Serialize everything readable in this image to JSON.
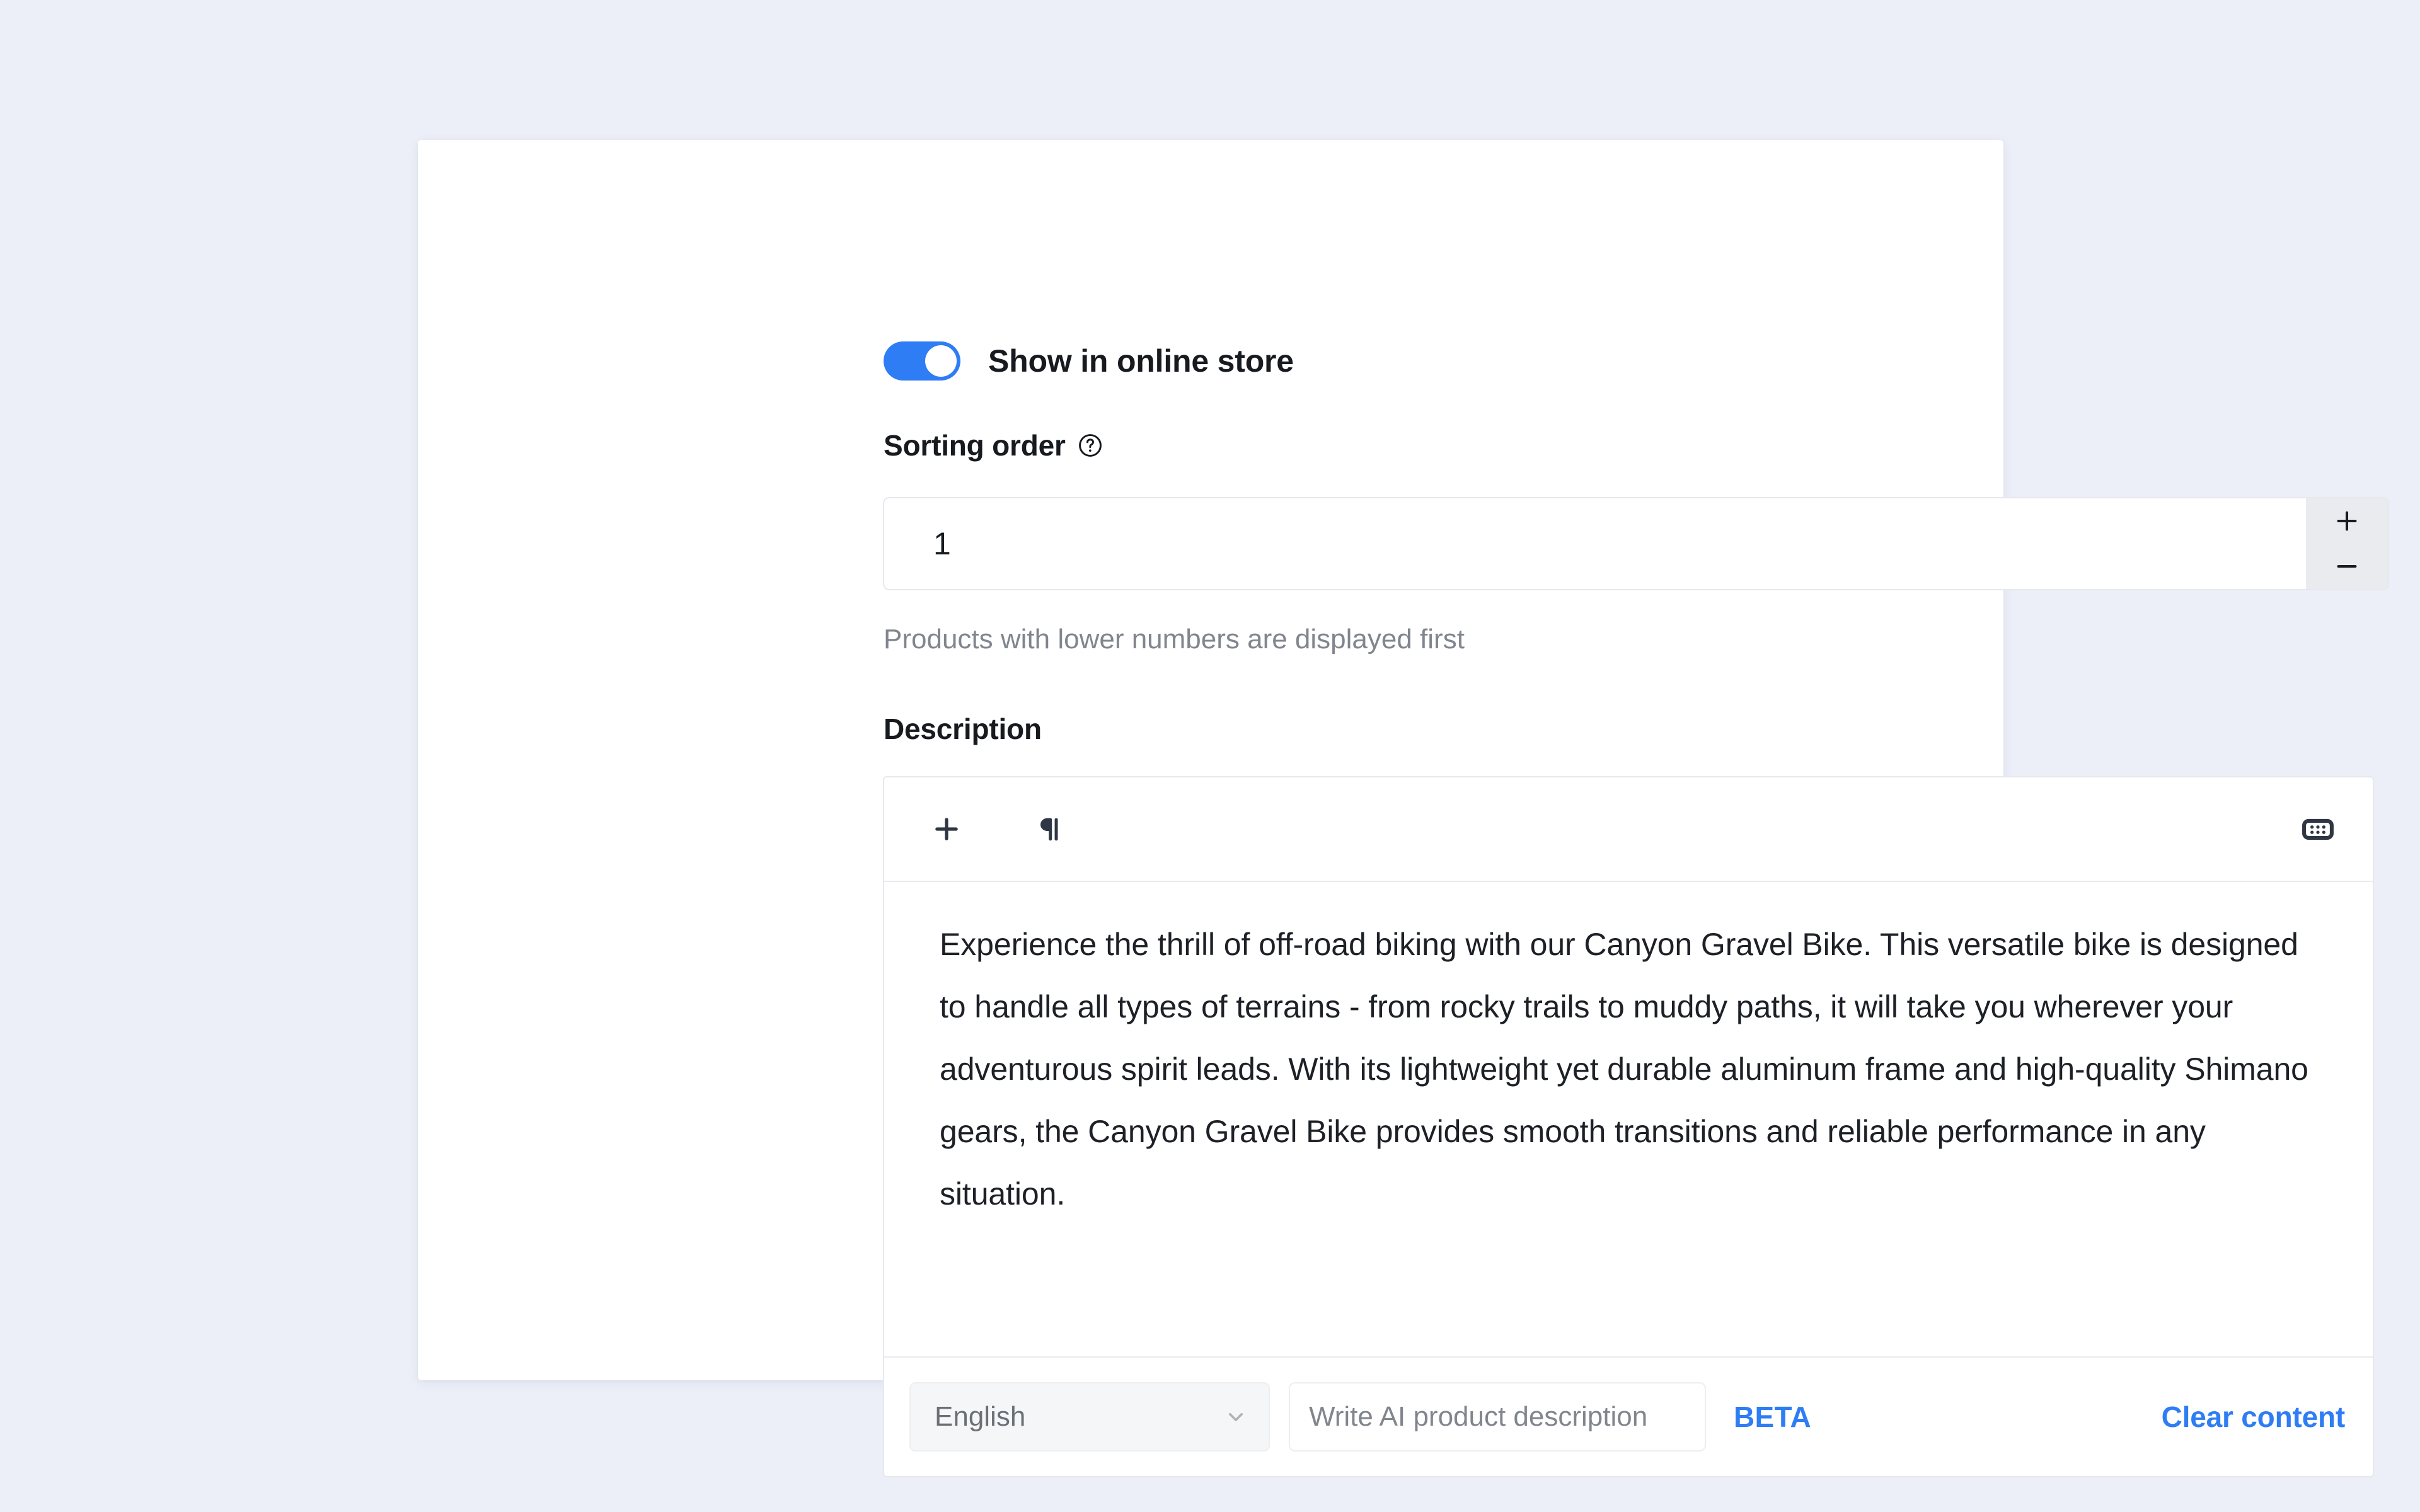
{
  "theme": {
    "page_background": "#eceff8",
    "card_background": "#ffffff",
    "accent_blue": "#2f7df4",
    "text_primary": "#171a1f",
    "text_muted": "#80858e",
    "border": "#e6e8ec",
    "stepper_background": "#e9ebef"
  },
  "visibility": {
    "toggle_label": "Show in online store",
    "toggle_state": "on",
    "toggle_icon": "toggle-on-icon"
  },
  "sorting": {
    "label": "Sorting order",
    "help_icon": "question-mark-circle-icon",
    "value": "1",
    "increment_icon": "plus-icon",
    "decrement_icon": "minus-icon",
    "helper_text": "Products with lower numbers are displayed first"
  },
  "description": {
    "label": "Description",
    "toolbar": {
      "add_icon": "plus-icon",
      "paragraph_icon": "pilcrow-icon",
      "keyboard_icon": "keyboard-icon"
    },
    "body_text": "Experience the thrill of off-road biking with our Canyon Gravel Bike. This versatile bike is designed to handle all types of terrains - from rocky trails to muddy paths, it will take you wherever your adventurous spirit leads. With its lightweight yet durable aluminum frame and high-quality Shimano gears, the Canyon Gravel Bike provides smooth transitions and reliable performance in any situation.",
    "footer": {
      "language_value": "English",
      "language_chevron_icon": "chevron-down-icon",
      "language_options": [
        "English"
      ],
      "ai_input_placeholder": "Write AI product description",
      "ai_input_value": "",
      "beta_badge": "BETA",
      "clear_link": "Clear content"
    }
  }
}
